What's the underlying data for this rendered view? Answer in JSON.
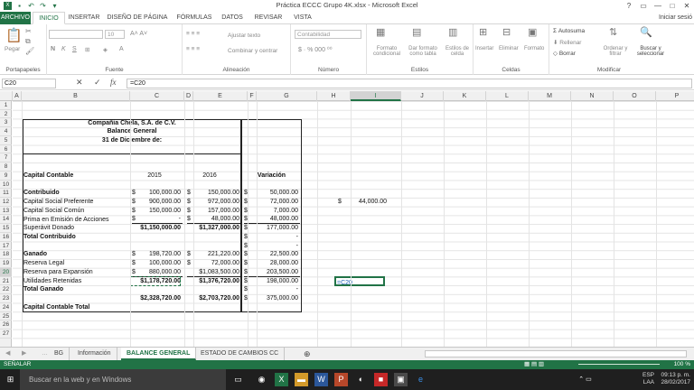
{
  "window": {
    "title": "Práctica ECCC Grupo 4K.xlsx - Microsoft Excel",
    "controls": [
      "?",
      "▭",
      "—",
      "□",
      "✕"
    ]
  },
  "tabs": {
    "archivo": "ARCHIVO",
    "inicio": "INICIO",
    "insertar": "INSERTAR",
    "diseno": "DISEÑO DE PÁGINA",
    "formulas": "FÓRMULAS",
    "datos": "DATOS",
    "revisar": "REVISAR",
    "vista": "VISTA",
    "user": "Iniciar sesió"
  },
  "ribbon": {
    "pegar": "Pegar",
    "portapapeles": "Portapapeles",
    "fuente": "Fuente",
    "font_size": "10",
    "ajustar": "Ajustar texto",
    "combinar": "Combinar y centrar",
    "alineacion": "Alineación",
    "number_format": "Contabilidad",
    "numero": "Número",
    "formato_cond": "Formato condicional",
    "dar_formato": "Dar formato como tabla",
    "estilos_celda": "Estilos de celda",
    "estilos": "Estilos",
    "insertar": "Insertar",
    "eliminar": "Eliminar",
    "formato": "Formato",
    "celdas": "Celdas",
    "autosuma": "Autosuma",
    "rellenar": "Rellenar",
    "borrar": "Borrar",
    "ordenar": "Ordenar y filtrar",
    "buscar": "Buscar y seleccionar",
    "modificar": "Modificar"
  },
  "formula_bar": {
    "name_box": "C20",
    "formula": "=C20",
    "fx": "fx"
  },
  "columns": [
    "A",
    "B",
    "C",
    "D",
    "E",
    "F",
    "G",
    "H",
    "I",
    "J",
    "K",
    "L",
    "M",
    "N",
    "O",
    "P"
  ],
  "rows": [
    "1",
    "2",
    "3",
    "4",
    "5",
    "6",
    "7",
    "8",
    "9",
    "10",
    "11",
    "12",
    "13",
    "14",
    "15",
    "16",
    "17",
    "18",
    "19",
    "20",
    "21",
    "22",
    "23",
    "24",
    "25",
    "26",
    "27"
  ],
  "sheet": {
    "company": "Compañia Chela, S.A. de C.V.",
    "report": "Balance General",
    "date": "31 de Diciembre de:",
    "h_capital": "Capital Contable",
    "h_2015": "2015",
    "h_2016": "2016",
    "h_var": "Variación",
    "contribuido": "Contribuido",
    "cap_pref": "Capital Social Preferente",
    "cap_comun": "Capital Social Común",
    "prima": "Prima en Emisión de Acciones",
    "superavit": "Superávit Donado",
    "total_contrib": "Total Contribuido",
    "ganado": "Ganado",
    "reserva_legal": "Reserva Legal",
    "reserva_exp": "Reserva para Expansión",
    "utilidades": "Utilidades Retenidas",
    "total_ganado": "Total Ganado",
    "cap_total": "Capital Contable Total",
    "cur": "$",
    "v15": [
      "100,000.00",
      "900,000.00",
      "150,000.00",
      "-",
      "$1,150,000.00",
      "",
      "198,720.00",
      "100,000.00",
      "880,000.00",
      "$1,178,720.00",
      "",
      "$2,328,720.00"
    ],
    "v16": [
      "150,000.00",
      "972,000.00",
      "157,000.00",
      "48,000.00",
      "$1,327,000.00",
      "",
      "221,220.00",
      "72,000.00",
      "$1,083,500.00",
      "$1,376,720.00",
      "",
      "$2,703,720.00"
    ],
    "var": [
      "50,000.00",
      "72,000.00",
      "7,000.00",
      "48,000.00",
      "177,000.00",
      "-",
      "-",
      "22,500.00",
      "28,000.00",
      "203,500.00",
      "198,000.00",
      "-",
      "375,000.00"
    ],
    "i11": "44,000.00",
    "i20": "=C20"
  },
  "sheet_tabs": [
    "BG",
    "Información",
    "BALANCE GENERAL",
    "ESTADO DE CAMBIOS CC"
  ],
  "status": {
    "mode": "SEÑALAR",
    "zoom": "100 %"
  },
  "taskbar": {
    "search": "Buscar en la web y en Windows",
    "lang1": "ESP",
    "lang2": "LAA",
    "time": "09:13 p. m.",
    "date": "28/02/2017"
  }
}
